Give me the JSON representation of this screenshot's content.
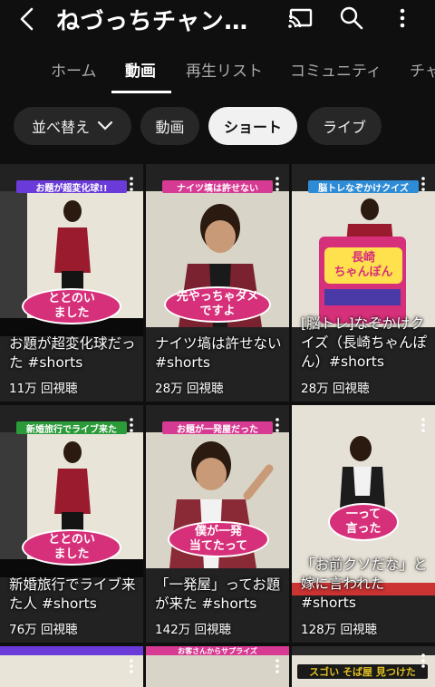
{
  "header": {
    "title": "ねづっちチャン…",
    "icons": [
      "back-arrow-icon",
      "cast-icon",
      "search-icon",
      "more-vert-icon"
    ]
  },
  "tabs": [
    {
      "label": "ホーム",
      "active": false
    },
    {
      "label": "動画",
      "active": true
    },
    {
      "label": "再生リスト",
      "active": false
    },
    {
      "label": "コミュニティ",
      "active": false
    },
    {
      "label": "チャ",
      "active": false
    }
  ],
  "chips": {
    "sort": {
      "label": "並べ替え"
    },
    "videos": {
      "label": "動画"
    },
    "shorts": {
      "label": "ショート",
      "selected": true
    },
    "live": {
      "label": "ライブ"
    }
  },
  "shorts": [
    {
      "banner": "お題が超変化球!!",
      "banner_color": "#6a3bd8",
      "bubble": "ととのい\nました",
      "title": "お題が超変化球だった #shorts",
      "views": "11万 回視聴",
      "bg": "#e8e4d8"
    },
    {
      "banner": "ナイツ塙は許せない",
      "banner_color": "#d63a92",
      "bubble": "先やっちゃダメ\nですよ",
      "title": "ナイツ塙は許せない #shorts",
      "views": "28万 回視聴",
      "bg": "#d9d4c8"
    },
    {
      "banner": "脳トレなぞかけクイズ",
      "banner_color": "#2e8bd6",
      "bubble": "長崎\nちゃんぽん",
      "title": "[脳トレ]なぞかけクイズ（長崎ちゃんぽん）#shorts",
      "views": "28万 回視聴",
      "bg": "#e6e1d6"
    },
    {
      "banner": "新婚旅行でライブ来た",
      "banner_color": "#2b9b3a",
      "bubble": "ととのい\nました",
      "title": "新婚旅行でライブ来た人 #shorts",
      "views": "76万 回視聴",
      "bg": "#e8e4d8"
    },
    {
      "banner": "お題が一発屋だった",
      "banner_color": "#d63a92",
      "bubble": "僕が一発\n当てたって",
      "title": "「一発屋」ってお題が来た #shorts",
      "views": "142万 回視聴",
      "bg": "#d9d4c8"
    },
    {
      "banner": "",
      "banner_color": "#cc3333",
      "bubble": "一って\n言った",
      "title": "「お前クソだな」と嫁に言われた #shorts",
      "views": "128万 回視聴",
      "bg": "#e6e1d6"
    }
  ],
  "partial_row": [
    {
      "banner": "",
      "color": "#6a3bd8"
    },
    {
      "banner": "お客さんからサプライズ",
      "color": "#d63a92"
    },
    {
      "banner": "スゴい そば屋 見つけた",
      "color": "#e0c020"
    }
  ],
  "colors": {
    "background": "#0f0f0f",
    "chip": "#272727",
    "chip_selected": "#f1f1f1",
    "accent_pink": "#d6307a"
  }
}
